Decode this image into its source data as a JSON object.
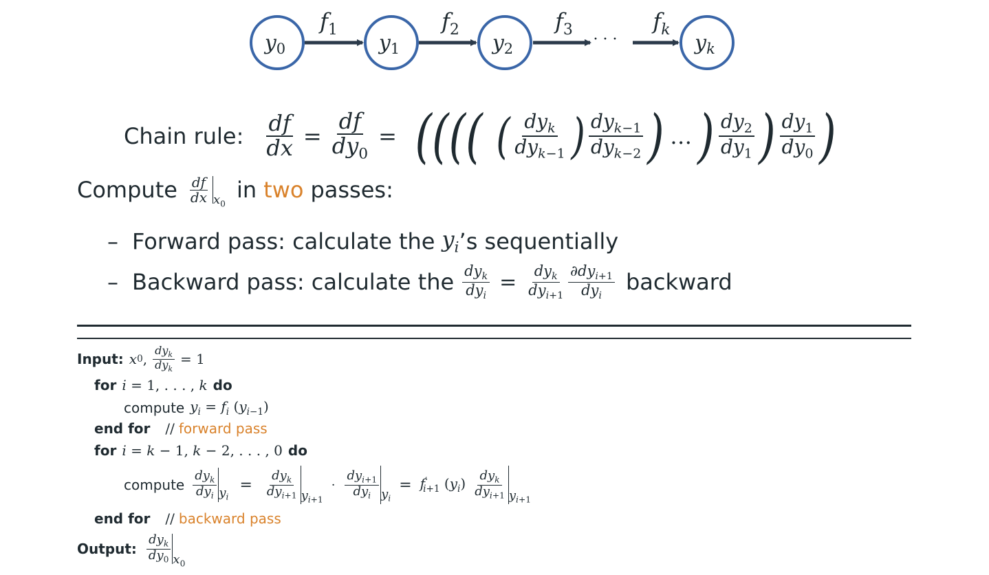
{
  "diagram": {
    "nodes": [
      "y0",
      "y1",
      "y2",
      "yk"
    ],
    "edges": [
      "f1",
      "f2",
      "f3",
      "fk"
    ],
    "ellipsis": "· · ·",
    "colors": {
      "node_stroke": "#3a66a8",
      "arrow": "#2b3a4a",
      "text": "#1f2a30"
    }
  },
  "chain_rule": {
    "label": "Chain rule:"
  },
  "compute_line": {
    "prefix": "Compute",
    "mid": "in",
    "highlight": "two",
    "suffix": "passes:",
    "highlight_color": "#d9822b"
  },
  "bullets": [
    {
      "dash": "–",
      "text_before": "Forward pass: calculate the",
      "text_after": "’s sequentially"
    },
    {
      "dash": "–",
      "text_before": "Backward pass: calculate the",
      "text_after": "backward"
    }
  ],
  "algorithm": {
    "input_label": "Input:",
    "for1_kw": "for",
    "do_kw": "do",
    "compute_kw": "compute",
    "end_for_kw": "end for",
    "comment_slashes": "//",
    "forward_comment": "forward pass",
    "backward_comment": "backward pass",
    "output_label": "Output:"
  }
}
